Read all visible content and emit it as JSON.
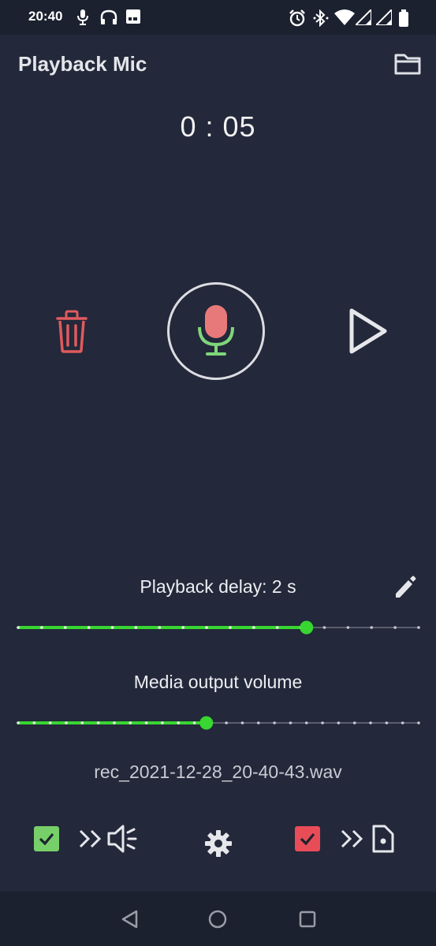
{
  "status_bar": {
    "time": "20:40",
    "left_icons": [
      "mic-icon",
      "headphones-icon",
      "gallery-icon"
    ],
    "right_icons": [
      "alarm-icon",
      "bluetooth-icon",
      "wifi-icon",
      "signal-icon",
      "signal-icon",
      "battery-icon"
    ]
  },
  "app_bar": {
    "title": "Playback Mic",
    "folder_icon": "folder-icon"
  },
  "timer": {
    "text": "0 : 05"
  },
  "controls": {
    "delete_icon": "trash-icon",
    "record_icon": "microphone-icon",
    "play_icon": "play-icon"
  },
  "delay": {
    "label": "Playback delay: 2 s",
    "edit_icon": "pencil-icon",
    "slider_value": 0.72
  },
  "volume": {
    "label": "Media output volume",
    "slider_value": 0.47
  },
  "recording": {
    "filename": "rec_2021-12-28_20-40-43.wav"
  },
  "bottom_bar": {
    "speaker_checked": true,
    "speaker_icon": "speaker-output-icon",
    "settings_icon": "gear-icon",
    "file_checked": true,
    "file_icon": "file-output-icon"
  },
  "nav_bar": {
    "buttons": [
      "back-icon",
      "home-icon",
      "recents-icon"
    ]
  },
  "colors": {
    "background": "#23283a",
    "accent_green": "#38d630",
    "delete_red": "#e05a5d",
    "checkbox_green": "#77cf69",
    "checkbox_red": "#e84c57",
    "mic_red": "#e8797b",
    "mic_green": "#7fd67a"
  }
}
